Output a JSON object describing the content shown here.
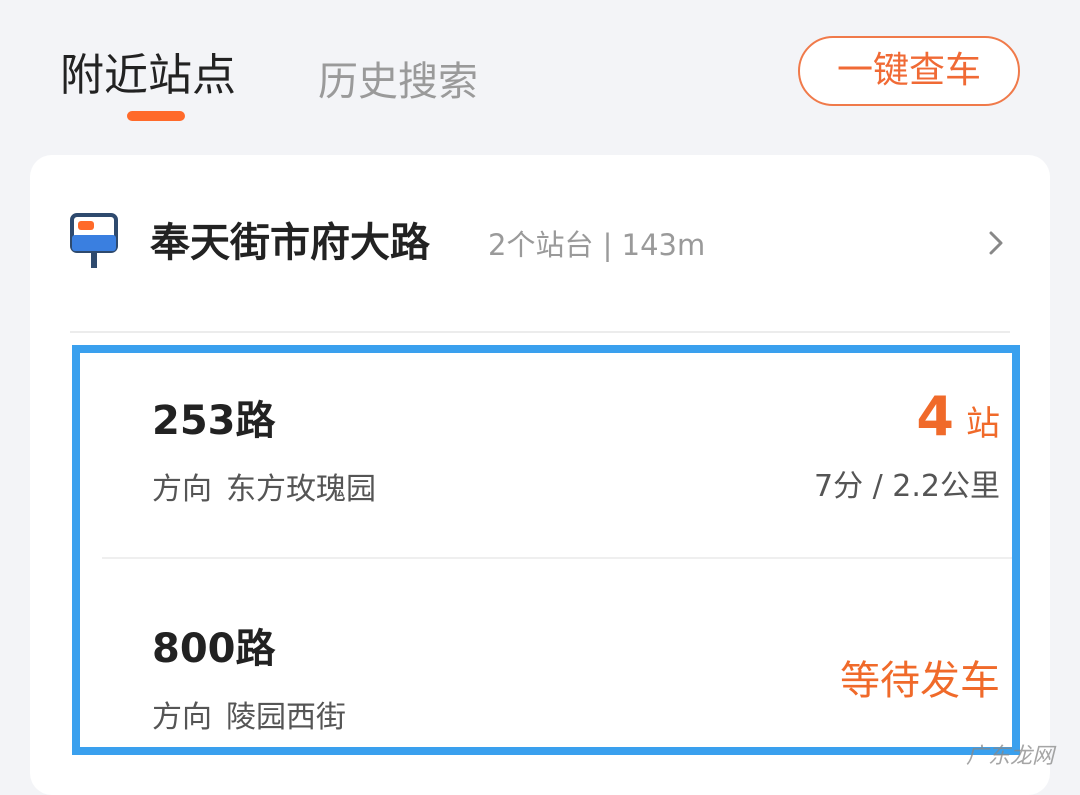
{
  "tabs": {
    "nearby": "附近站点",
    "history": "历史搜索"
  },
  "header": {
    "check_button": "一键查车"
  },
  "station": {
    "name": "奉天街市府大路",
    "meta": "2个站台 | 143m",
    "icon": "bus-stop-sign-icon"
  },
  "routes": [
    {
      "name": "253路",
      "direction_label": "方向",
      "direction": "东方玫瑰园",
      "stops_count": "4",
      "stops_unit": "站",
      "eta": "7分 / 2.2公里"
    },
    {
      "name": "800路",
      "direction_label": "方向",
      "direction": "陵园西街",
      "status": "等待发车"
    }
  ],
  "watermark": "广东龙网",
  "colors": {
    "accent": "#f06a2a",
    "highlight_border": "#3aa0ee",
    "background": "#f3f4f7"
  }
}
